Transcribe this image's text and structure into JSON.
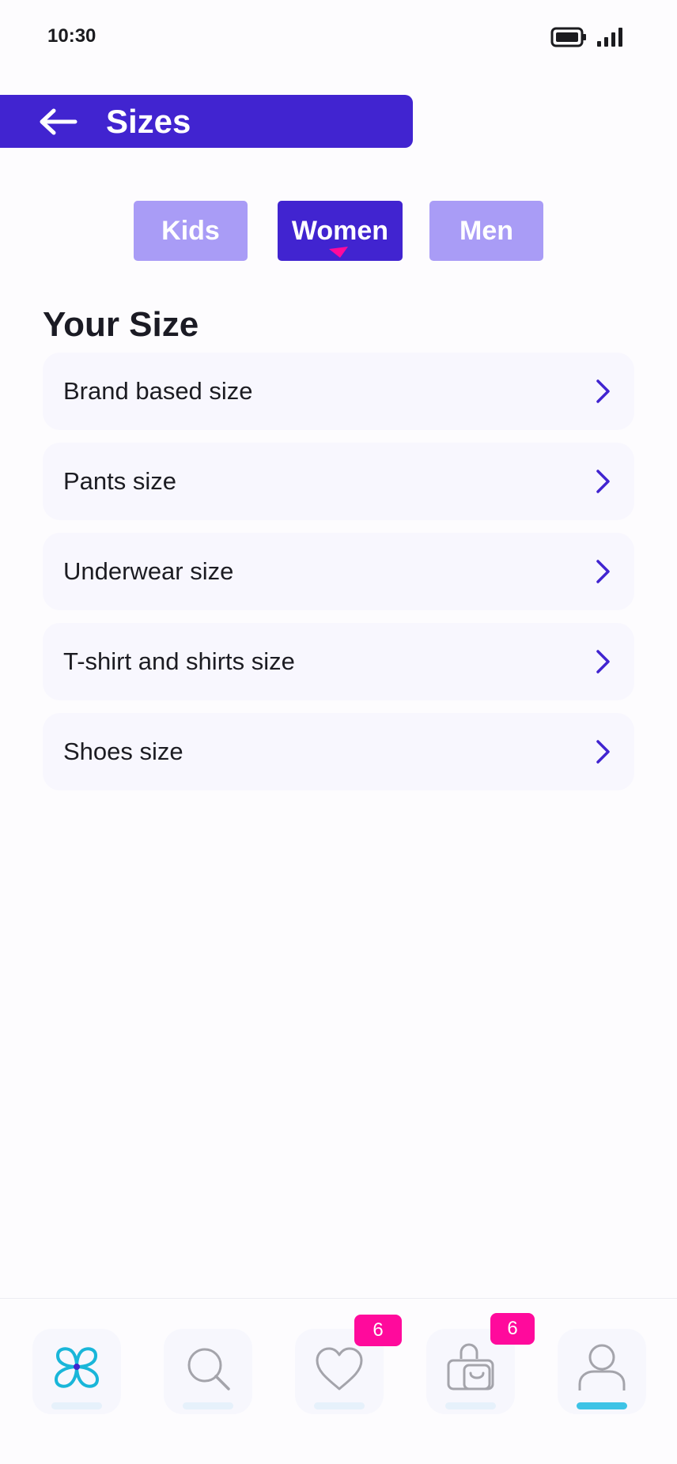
{
  "status_bar": {
    "time": "10:30",
    "icons": [
      "battery-icon",
      "signal-icon"
    ]
  },
  "header": {
    "title": "Sizes",
    "back_icon": "arrow-left-icon",
    "color": "#4124d0"
  },
  "tabs": [
    {
      "label": "Kids",
      "active": false
    },
    {
      "label": "Women",
      "active": true
    },
    {
      "label": "Men",
      "active": false
    }
  ],
  "section": {
    "title": "Your Size",
    "items": [
      {
        "label": "Brand based size"
      },
      {
        "label": "Pants size"
      },
      {
        "label": "Underwear size"
      },
      {
        "label": "T-shirt and shirts size"
      },
      {
        "label": "Shoes size"
      }
    ]
  },
  "bottom_nav": {
    "items": [
      {
        "name": "home",
        "icon": "logo-icon",
        "active": false
      },
      {
        "name": "search",
        "icon": "search-icon",
        "active": false
      },
      {
        "name": "favorites",
        "icon": "heart-icon",
        "active": false,
        "badge": "6"
      },
      {
        "name": "cart",
        "icon": "shopping-bag-icon",
        "active": false,
        "badge": "6"
      },
      {
        "name": "profile",
        "icon": "user-icon",
        "active": true
      }
    ]
  },
  "colors": {
    "primary": "#4124d0",
    "tab_inactive": "#a99cf6",
    "badge": "#ff0a9c",
    "accent": "#3dc3e6"
  }
}
